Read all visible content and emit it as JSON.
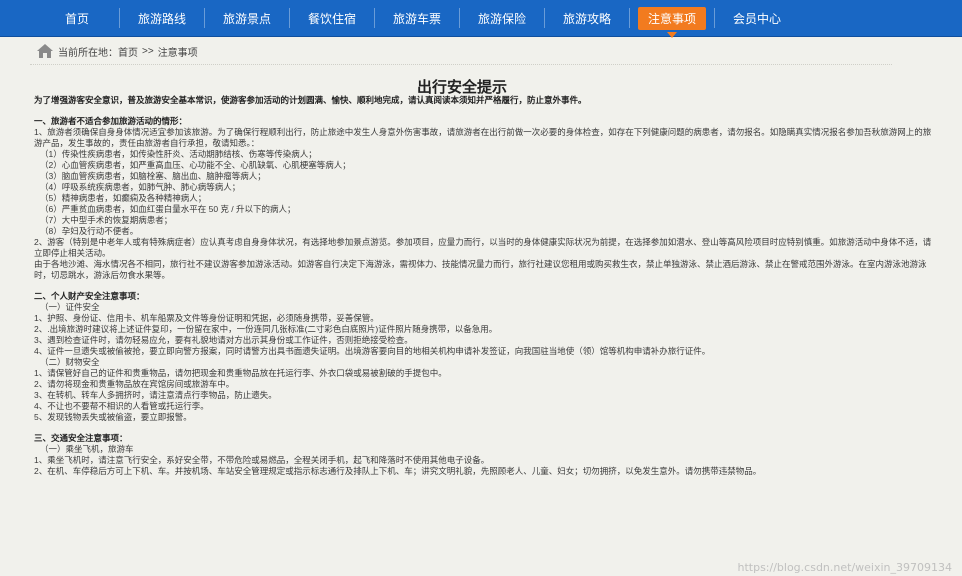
{
  "nav": {
    "items": [
      {
        "label": "首页",
        "active": false
      },
      {
        "label": "旅游路线",
        "active": false
      },
      {
        "label": "旅游景点",
        "active": false
      },
      {
        "label": "餐饮住宿",
        "active": false
      },
      {
        "label": "旅游车票",
        "active": false
      },
      {
        "label": "旅游保险",
        "active": false
      },
      {
        "label": "旅游攻略",
        "active": false
      },
      {
        "label": "注意事项",
        "active": true
      },
      {
        "label": "会员中心",
        "active": false
      }
    ],
    "bg_color": "#1967c4",
    "active_color": "#f27b1f"
  },
  "breadcrumb": {
    "prefix": "当前所在地：",
    "home": "首页",
    "separator": ">>",
    "current": "注意事项"
  },
  "article": {
    "title": "出行安全提示",
    "intro": "为了增强游客安全意识，普及旅游安全基本常识，使游客参加活动的计划圆满、愉快、顺利地完成，请认真阅读本须知并严格履行，防止意外事件。",
    "sections": [
      {
        "heading": "一、旅游者不适合参加旅游活动的情形：",
        "lines": [
          "1、旅游者须确保自身身体情况适宜参加该旅游。为了确保行程顺利出行，防止旅途中发生人身意外伤害事故，请旅游者在出行前做一次必要的身体检查，如存在下列健康问题的病患者，请勿报名。如隐瞒真实情况报名参加吾秋旅游网上的旅游产品，发生事故的，责任由旅游者自行承担，敬请知悉。：",
          "（1）传染性疾病患者，如传染性肝炎、活动期肺结核、伤寒等传染病人；",
          "（2）心血管疾病患者，如严重高血压、心功能不全、心肌缺氧、心肌梗塞等病人；",
          "（3）脑血管疾病患者，如脑栓塞、脑出血、脑肿瘤等病人；",
          "（4）呼吸系统疾病患者，如肺气肿、肺心病等病人；",
          "（5）精神病患者，如癫痫及各种精神病人；",
          "（6）严重贫血病患者，如血红蛋白量水平在 50 克 / 升以下的病人；",
          "（7）大中型手术的恢复期病患者；",
          "（8）孕妇及行动不便者。",
          "2、游客（特别是中老年人或有特殊病症者）应认真考虑自身身体状况，有选择地参加景点游览。参加项目，应量力而行，以当时的身体健康实际状况为前提，在选择参加如潜水、登山等高风险项目时应特别慎重。如旅游活动中身体不适，请立即停止相关活动。",
          "由于各地沙滩、海水情况各不相同，旅行社不建议游客参加游泳活动。如游客自行决定下海游泳，需视体力、技能情况量力而行，旅行社建议您租用或购买救生衣，禁止单独游泳、禁止酒后游泳、禁止在警戒范围外游泳。在室内游泳池游泳时，切忌跳水，游泳后勿食水果等。"
        ]
      },
      {
        "heading": "二、个人财产安全注意事项：",
        "lines": [
          "（一）证件安全",
          "1、护照、身份证、信用卡、机车船票及文件等身份证明和凭据，必须随身携带，妥善保管。",
          "2、.出境旅游时建议将上述证件复印，一份留在家中，一份连同几张标准(二寸彩色白底照片)证件照片随身携带，以备急用。",
          "3、遇到检查证件时，请勿轻易应允，要有礼貌地请对方出示其身份或工作证件，否则拒绝接受检查。",
          "4、证件一旦遗失或被偷被抢，要立即向警方报案，同时请警方出具书面遗失证明。出境游客要向目的地相关机构申请补发签证，向我国驻当地使（领）馆等机构申请补办旅行证件。",
          "（二）财物安全",
          "1、请保管好自己的证件和贵重物品，请勿把现金和贵重物品放在托运行李、外衣口袋或易被割破的手提包中。",
          "2、请勿将现金和贵重物品放在宾馆房间或旅游车中。",
          "3、在转机、转车人多拥挤时，请注意清点行李物品，防止遗失。",
          "4、不让也不要帮不相识的人看管或托运行李。",
          "5、发现钱物丢失或被偷盗，要立即报警。"
        ]
      },
      {
        "heading": "三、交通安全注意事项：",
        "lines": [
          "（一）乘坐飞机，旅游车",
          "1、乘坐飞机时，请注意飞行安全，系好安全带，不带危险或易燃品，全程关闭手机，起飞和降落时不使用其他电子设备。",
          "2、在机、车停稳后方可上下机、车。并按机场、车站安全管理规定或指示标志通行及排队上下机、车；讲究文明礼貌，先照顾老人、儿童、妇女；切勿拥挤，以免发生意外。请勿携带违禁物品。"
        ]
      }
    ]
  },
  "watermark": "https://blog.csdn.net/weixin_39709134"
}
